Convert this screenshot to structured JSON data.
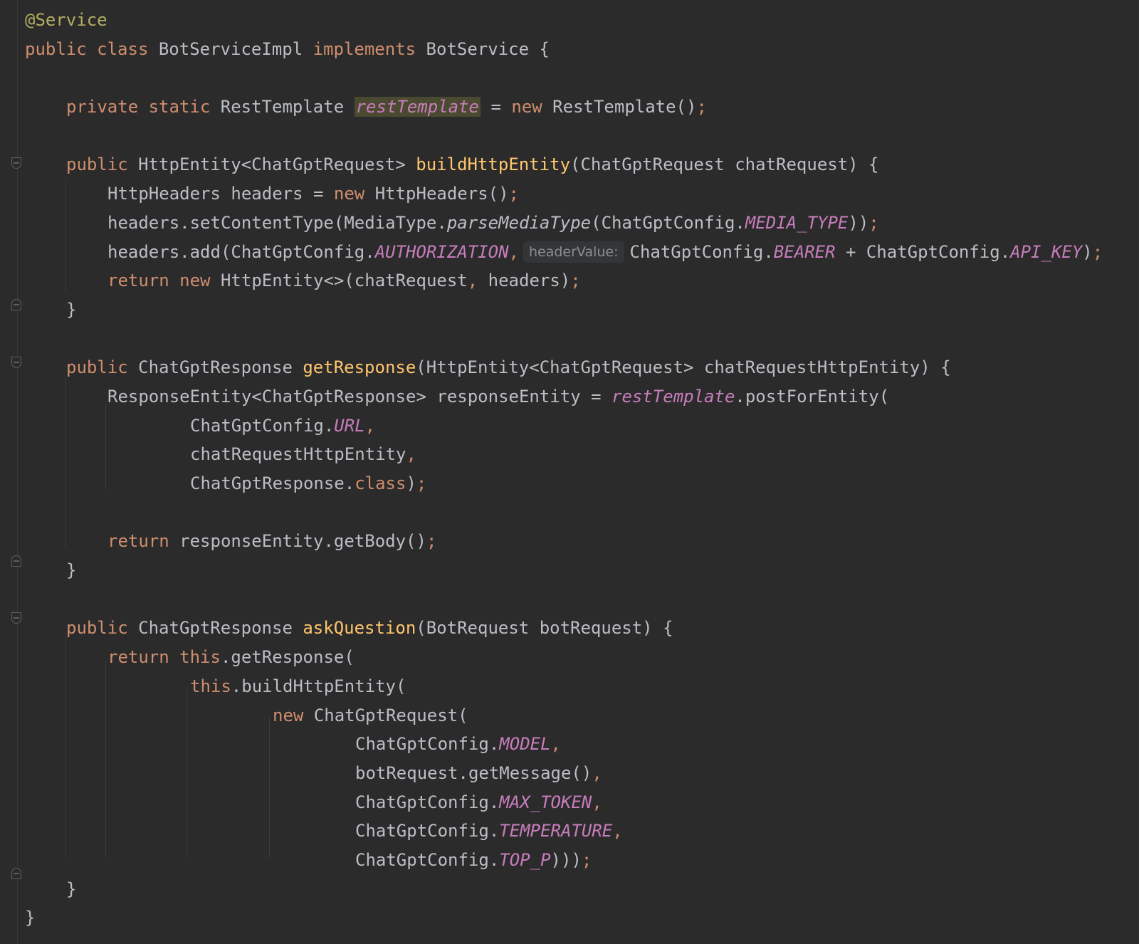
{
  "hint": {
    "label": "headerValue:"
  },
  "icons": {
    "fold_open": "fold-open-icon",
    "fold_close": "fold-close-icon"
  },
  "lines": {
    "l1": [
      "@Service"
    ],
    "l2": [
      "public",
      " ",
      "class",
      " BotServiceImpl ",
      "implements",
      " BotService {"
    ],
    "l4": [
      "private",
      " ",
      "static",
      " RestTemplate ",
      "restTemplate",
      " = ",
      "new",
      " RestTemplate()",
      ";"
    ],
    "l6": [
      "public",
      " HttpEntity<ChatGptRequest> ",
      "buildHttpEntity",
      "(ChatGptRequest chatRequest) {"
    ],
    "l7": [
      "HttpHeaders headers = ",
      "new",
      " HttpHeaders()",
      ";"
    ],
    "l8": [
      "headers.setContentType(MediaType.",
      "parseMediaType",
      "(ChatGptConfig.",
      "MEDIA_TYPE",
      "))",
      ";"
    ],
    "l9": [
      "headers.add(ChatGptConfig.",
      "AUTHORIZATION",
      ",",
      "ChatGptConfig.",
      "BEARER",
      " + ChatGptConfig.",
      "API_KEY",
      ")",
      ";"
    ],
    "l10": [
      "return",
      " ",
      "new",
      " HttpEntity<>(chatRequest",
      ",",
      " headers)",
      ";"
    ],
    "l11": [
      "}"
    ],
    "l13": [
      "public",
      " ChatGptResponse ",
      "getResponse",
      "(HttpEntity<ChatGptRequest> chatRequestHttpEntity) {"
    ],
    "l14": [
      "ResponseEntity<ChatGptResponse> responseEntity = ",
      "restTemplate",
      ".postForEntity("
    ],
    "l15": [
      "ChatGptConfig.",
      "URL",
      ","
    ],
    "l16": [
      "chatRequestHttpEntity",
      ","
    ],
    "l17": [
      "ChatGptResponse.",
      "class",
      ")",
      ";"
    ],
    "l19": [
      "return",
      " responseEntity.getBody()",
      ";"
    ],
    "l20": [
      "}"
    ],
    "l22": [
      "public",
      " ChatGptResponse ",
      "askQuestion",
      "(BotRequest botRequest) {"
    ],
    "l23": [
      "return",
      " ",
      "this",
      ".getResponse("
    ],
    "l24": [
      "this",
      ".buildHttpEntity("
    ],
    "l25": [
      "new",
      " ChatGptRequest("
    ],
    "l26": [
      "ChatGptConfig.",
      "MODEL",
      ","
    ],
    "l27": [
      "botRequest.getMessage()",
      ","
    ],
    "l28": [
      "ChatGptConfig.",
      "MAX_TOKEN",
      ","
    ],
    "l29": [
      "ChatGptConfig.",
      "TEMPERATURE",
      ","
    ],
    "l30": [
      "ChatGptConfig.",
      "TOP_P",
      ")))",
      ";"
    ],
    "l31": [
      "}"
    ],
    "l32": [
      "}"
    ]
  }
}
